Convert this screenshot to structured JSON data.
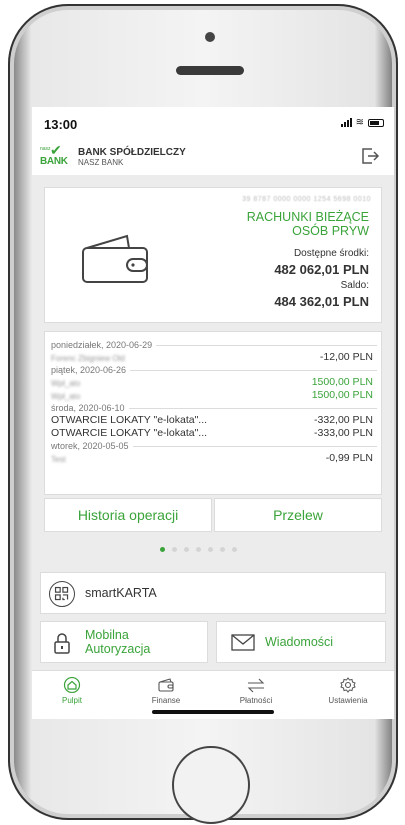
{
  "status": {
    "time": "13:00"
  },
  "bank": {
    "logo_top": "nasz",
    "logo_main": "BANK",
    "name": "BANK SPÓŁDZIELCZY",
    "subname": "NASZ BANK"
  },
  "account": {
    "number": "39 8787 0000 0000 1254 5698 0010",
    "type_line1": "RACHUNKI BIEŻĄCE",
    "type_line2": "OSÓB PRYW",
    "available_label": "Dostępne środki:",
    "available_value": "482 062,01 PLN",
    "balance_label": "Saldo:",
    "balance_value": "484 362,01 PLN"
  },
  "operations": [
    {
      "date": "poniedziałek, 2020-06-29",
      "items": [
        {
          "desc": "Forenc Zbigniew Old",
          "blur": true,
          "value": "-12,00 PLN",
          "positive": false
        }
      ]
    },
    {
      "date": "piątek, 2020-06-26",
      "items": [
        {
          "desc": "Wpł_ato",
          "blur": true,
          "value": "1500,00 PLN",
          "positive": true
        },
        {
          "desc": "Wpł_ato",
          "blur": true,
          "value": "1500,00 PLN",
          "positive": true
        }
      ]
    },
    {
      "date": "środa, 2020-06-10",
      "items": [
        {
          "desc": "OTWARCIE LOKATY \"e-lokata\"...",
          "blur": false,
          "value": "-332,00 PLN",
          "positive": false
        },
        {
          "desc": "OTWARCIE LOKATY \"e-lokata\"...",
          "blur": false,
          "value": "-333,00 PLN",
          "positive": false
        }
      ]
    },
    {
      "date": "wtorek, 2020-05-05",
      "items": [
        {
          "desc": "Test",
          "blur": true,
          "value": "-0,99 PLN",
          "positive": false
        }
      ]
    }
  ],
  "actions": {
    "history": "Historia operacji",
    "transfer": "Przelew"
  },
  "carousel": {
    "count": 7,
    "active": 0
  },
  "tiles": {
    "smartkarta": "smartKARTA",
    "mobile_auth_1": "Mobilna",
    "mobile_auth_2": "Autoryzacja",
    "messages": "Wiadomości"
  },
  "tabs": [
    {
      "label": "Pulpit",
      "icon": "home-icon",
      "active": true
    },
    {
      "label": "Finanse",
      "icon": "wallet-icon",
      "active": false
    },
    {
      "label": "Płatności",
      "icon": "transfer-arrows-icon",
      "active": false
    },
    {
      "label": "Ustawienia",
      "icon": "gear-icon",
      "active": false
    }
  ],
  "colors": {
    "brand": "#3aa33a",
    "text": "#333333",
    "background": "#ececec"
  }
}
